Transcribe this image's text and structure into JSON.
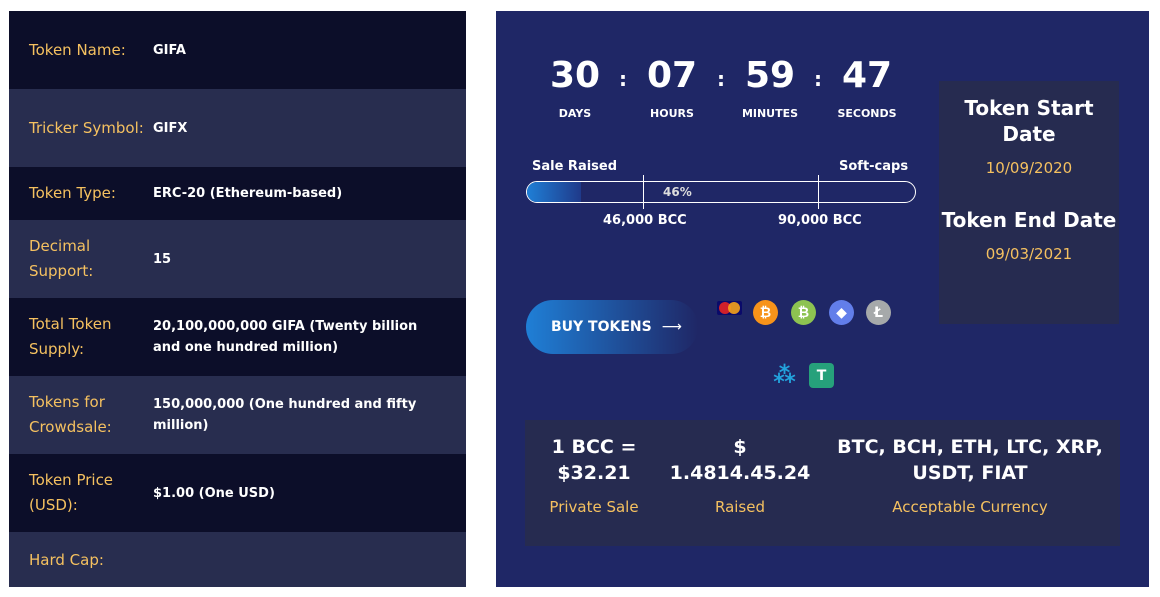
{
  "details": [
    {
      "label": "Token Name:",
      "value": "GIFA"
    },
    {
      "label": "Tricker Symbol:",
      "value": "GIFX"
    },
    {
      "label": "Token Type:",
      "value": "ERC-20 (Ethereum-based)"
    },
    {
      "label": "Decimal Support:",
      "value": "15"
    },
    {
      "label": "Total Token Supply:",
      "value": "20,100,000,000 GIFA (Twenty billion and one hundred million)"
    },
    {
      "label": "Tokens for Crowdsale:",
      "value": "150,000,000 (One hundred and fifty million)"
    },
    {
      "label": "Token Price (USD):",
      "value": "$1.00 (One USD)"
    },
    {
      "label": "Hard Cap:",
      "value": ""
    }
  ],
  "countdown": [
    {
      "value": "30",
      "unit": "DAYS"
    },
    {
      "value": "07",
      "unit": "HOURS"
    },
    {
      "value": "59",
      "unit": "MINUTES"
    },
    {
      "value": "47",
      "unit": "SECONDS"
    }
  ],
  "colon": ":",
  "progress": {
    "left_label": "Sale Raised",
    "right_label": "Soft-caps",
    "percent": 46,
    "percent_label": "46%",
    "marker1": "46,000 BCC",
    "marker2": "90,000 BCC"
  },
  "buy": {
    "label": "BUY TOKENS",
    "arrow": "⟶"
  },
  "payment_icons": [
    "mastercard-icon",
    "bitcoin-icon",
    "bitcoin-cash-icon",
    "ethereum-icon",
    "litecoin-icon",
    "ripple-icon",
    "tether-icon"
  ],
  "dates": {
    "start_title": "Token Start Date",
    "start": "10/09/2020",
    "end_title": "Token End Date",
    "end": "09/03/2021"
  },
  "stats": [
    {
      "value": "1 BCC = $32.21",
      "caption": "Private Sale"
    },
    {
      "value": "$ 1.4814.45.24",
      "caption": "Raised"
    },
    {
      "value": "BTC, BCH, ETH, LTC, XRP, USDT, FIAT",
      "caption": "Acceptable Currency"
    }
  ],
  "colors": {
    "accent": "#f5c160",
    "panel": "#1f2766",
    "dark_row": "#0c0e29",
    "light_row": "#282d4f"
  }
}
